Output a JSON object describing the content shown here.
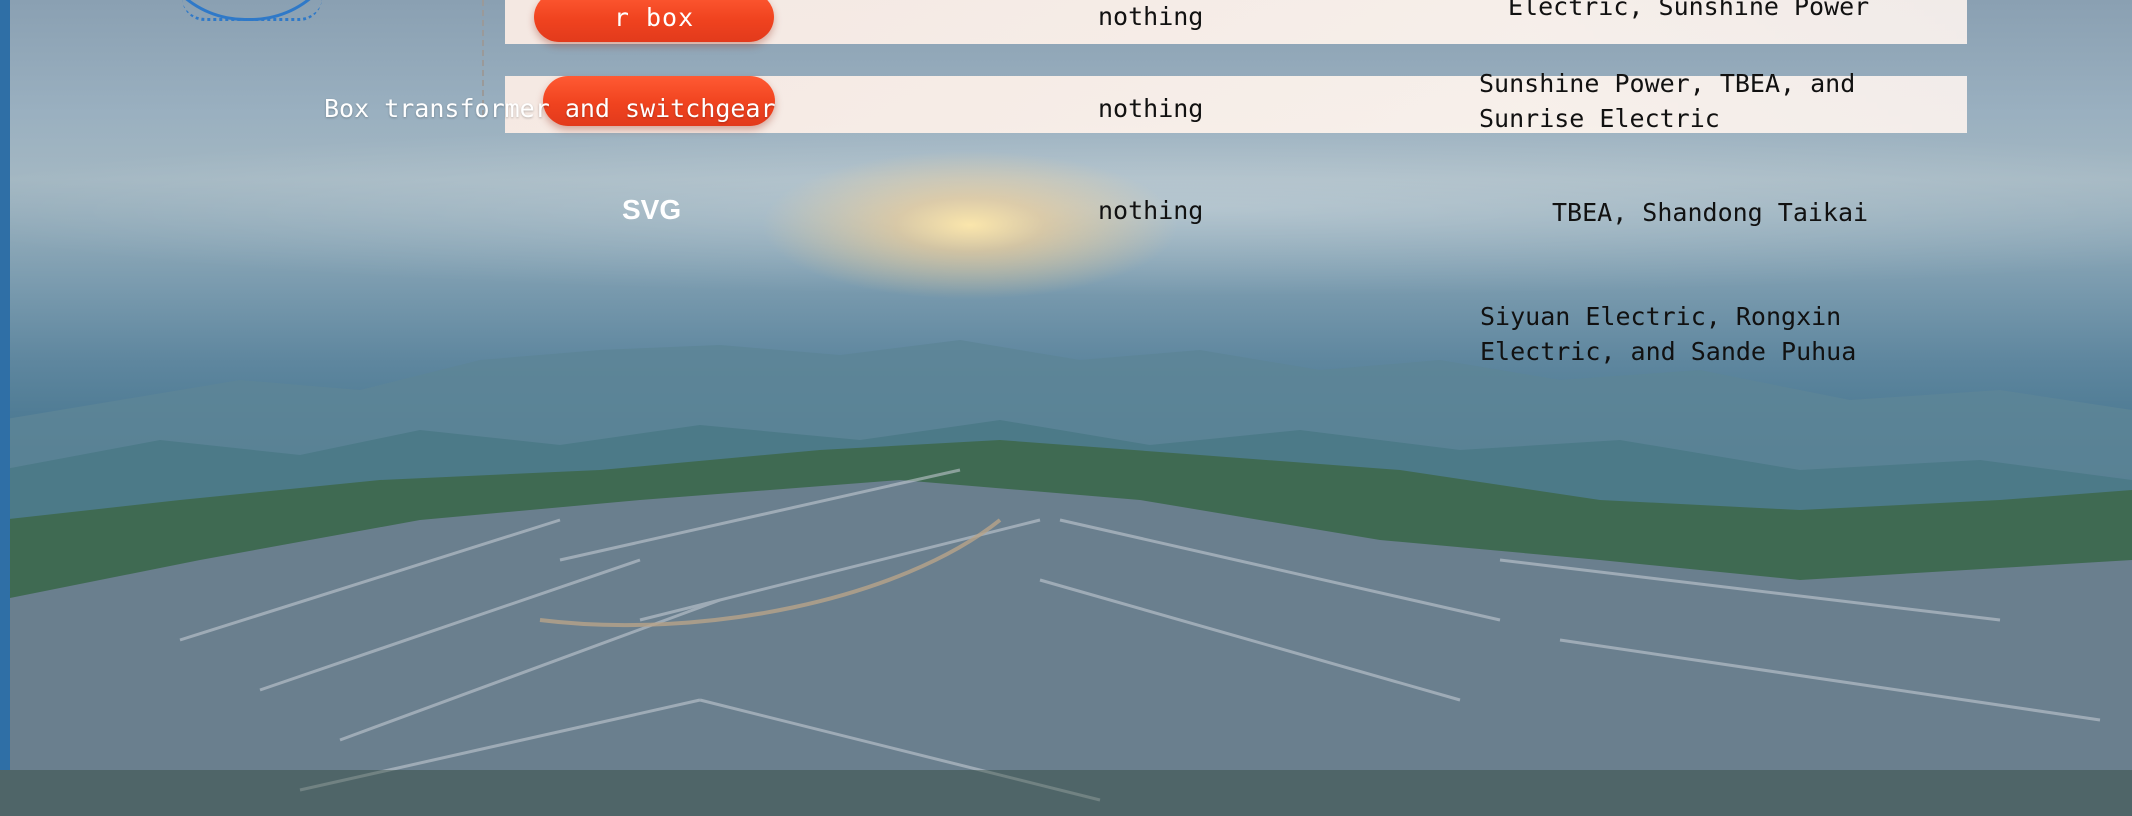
{
  "rows": [
    {
      "component": "r box",
      "status": "nothing",
      "suppliers": [
        "Electric, Sunshine Power"
      ]
    },
    {
      "component": "Box transformer and switchgear",
      "status": "nothing",
      "suppliers": [
        "Sunshine Power, TBEA, and",
        "Sunrise Electric"
      ]
    },
    {
      "component": "SVG",
      "status": "nothing",
      "suppliers": [
        "TBEA, Shandong Taikai"
      ]
    },
    {
      "component": "",
      "status": "",
      "suppliers": [
        "Siyuan Electric, Rongxin",
        "Electric, and Sande Puhua"
      ]
    }
  ],
  "colors": {
    "accent_pill": "#f0431f",
    "row_band": "#fdeee6",
    "diagram_blue": "#2f79c8"
  }
}
